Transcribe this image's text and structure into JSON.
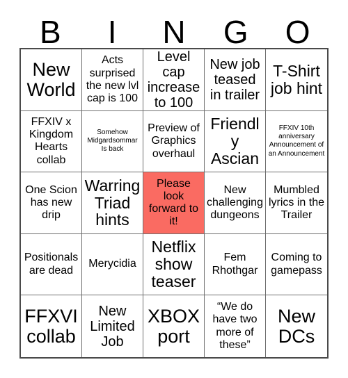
{
  "header": {
    "letters": [
      "B",
      "I",
      "N",
      "G",
      "O"
    ]
  },
  "colors": {
    "marked_cell": "#fa6b62",
    "grid_line": "#6e6e6e",
    "grid_border": "#4a4a4a",
    "cell_background": "#ffffff",
    "text": "#000000"
  },
  "grid": {
    "rows": 5,
    "columns": 5,
    "cells": [
      {
        "text": "New World",
        "marked": false,
        "size": "xxl"
      },
      {
        "text": "Acts surprised the new lvl cap is 100",
        "marked": false,
        "size": "md"
      },
      {
        "text": "Level cap increase to 100",
        "marked": false,
        "size": "lg"
      },
      {
        "text": "New job teased in trailer",
        "marked": false,
        "size": "lg"
      },
      {
        "text": "T-Shirt job hint",
        "marked": false,
        "size": "xl"
      },
      {
        "text": "FFXIV x Kingdom Hearts collab",
        "marked": false,
        "size": "md"
      },
      {
        "text": "Somehow Midgardsommar Is back",
        "marked": false,
        "size": "xs"
      },
      {
        "text": "Preview of Graphics overhaul",
        "marked": false,
        "size": "md"
      },
      {
        "text": "Friendly Ascian",
        "marked": false,
        "size": "xl"
      },
      {
        "text": "FFXIV 10th anniversary Announcement of an Announcement",
        "marked": false,
        "size": "xs"
      },
      {
        "text": "One Scion has new drip",
        "marked": false,
        "size": "md"
      },
      {
        "text": "Warring Triad hints",
        "marked": false,
        "size": "xl"
      },
      {
        "text": "Please look forward to it!",
        "marked": true,
        "size": "md"
      },
      {
        "text": "New challenging dungeons",
        "marked": false,
        "size": "md"
      },
      {
        "text": "Mumbled lyrics in the Trailer",
        "marked": false,
        "size": "md"
      },
      {
        "text": "Positionals are dead",
        "marked": false,
        "size": "md"
      },
      {
        "text": "Merycidia",
        "marked": false,
        "size": "md"
      },
      {
        "text": "Netflix show teaser",
        "marked": false,
        "size": "xl"
      },
      {
        "text": "Fem Rhothgar",
        "marked": false,
        "size": "md"
      },
      {
        "text": "Coming to gamepass",
        "marked": false,
        "size": "md"
      },
      {
        "text": "FFXVI collab",
        "marked": false,
        "size": "xxl"
      },
      {
        "text": "New Limited Job",
        "marked": false,
        "size": "lg"
      },
      {
        "text": "XBOX port",
        "marked": false,
        "size": "xxl"
      },
      {
        "text": "“We do have two more of these”",
        "marked": false,
        "size": "md"
      },
      {
        "text": "New DCs",
        "marked": false,
        "size": "xxl"
      }
    ]
  }
}
